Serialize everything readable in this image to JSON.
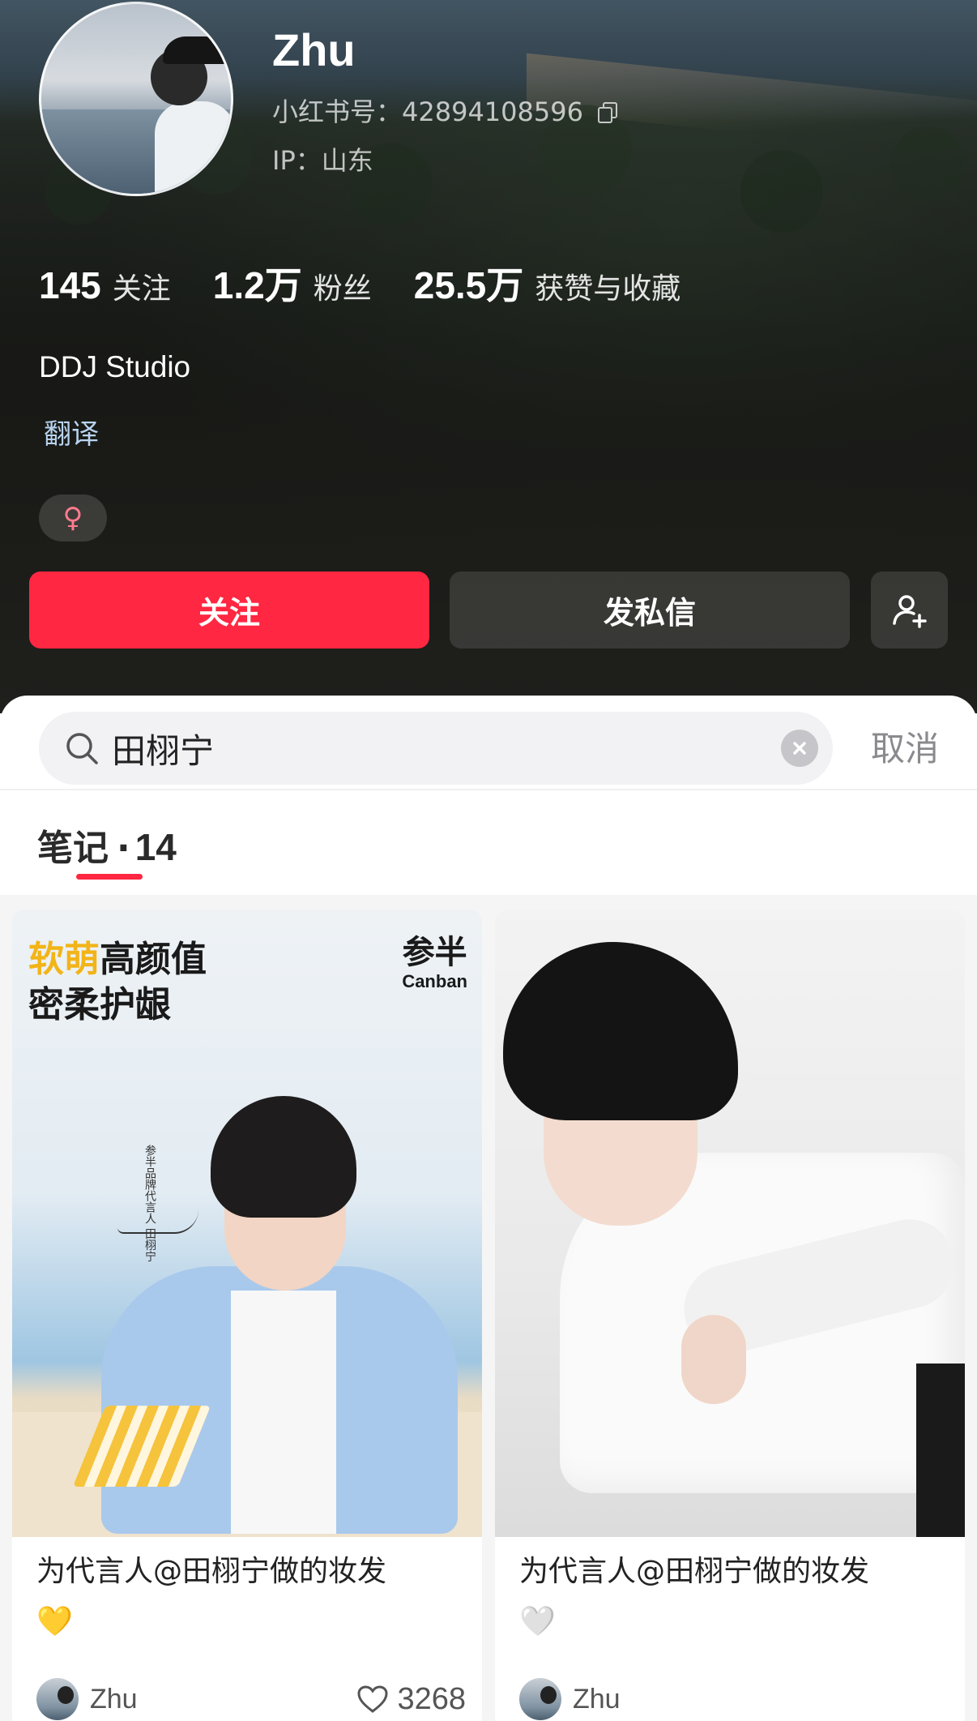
{
  "profile": {
    "name": "Zhu",
    "red_id": "小红书号：42894108596",
    "ip": "IP：山东",
    "stats": [
      {
        "num": "145",
        "label": "关注"
      },
      {
        "num": "1.2万",
        "label": "粉丝"
      },
      {
        "num": "25.5万",
        "label": "获赞与收藏"
      }
    ],
    "bio": "DDJ Studio",
    "translate": "翻译",
    "gender_symbol": "♀",
    "gender_color": "#ff7b8f"
  },
  "actions": {
    "follow_label": "关注",
    "message_label": "发私信",
    "follow_color": "#ff2741"
  },
  "search": {
    "query": "田栩宁",
    "cancel_label": "取消"
  },
  "tabs": {
    "notes_label": "笔记",
    "notes_count": "14"
  },
  "cards": [
    {
      "image": {
        "headline_accent": "软萌",
        "headline_rest": "高颜值",
        "headline_line2": "密柔护龈",
        "brand_cn": "参半",
        "brand_en": "Canban",
        "vertical_text": "参半品牌代言人 田栩宁"
      },
      "title": "为代言人@田栩宁做的妆发",
      "emoji": "💛",
      "author": "Zhu",
      "likes": "3268"
    },
    {
      "title": "为代言人@田栩宁做的妆发",
      "emoji": "🤍",
      "author": "Zhu"
    }
  ],
  "icons": {
    "copy": "copy-icon",
    "add_user": "add-user-icon",
    "search": "search-icon",
    "clear": "clear-icon",
    "heart": "heart-icon"
  }
}
